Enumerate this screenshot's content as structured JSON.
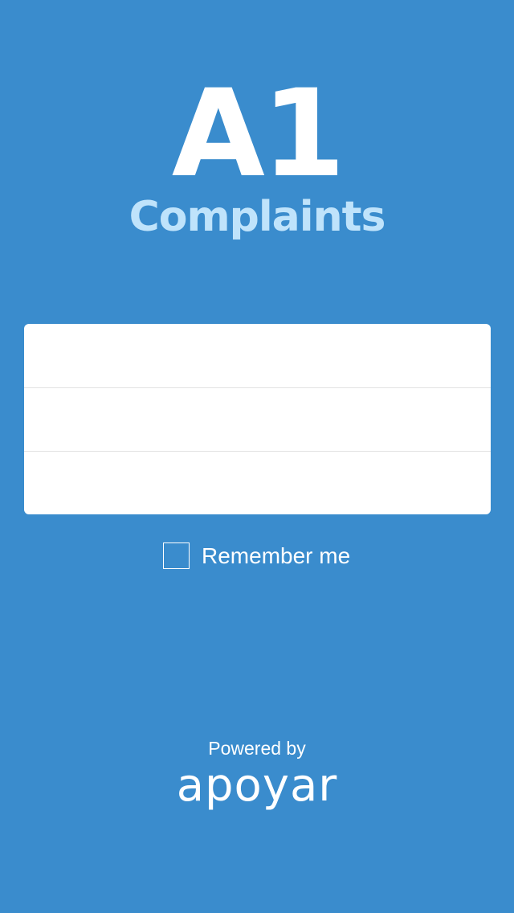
{
  "app": {
    "title": "A1",
    "subtitle": "Complaints"
  },
  "form": {
    "field_1": {
      "value": "",
      "placeholder": ""
    },
    "field_2": {
      "value": "",
      "placeholder": ""
    },
    "field_3": {
      "value": "",
      "placeholder": ""
    }
  },
  "remember": {
    "label": "Remember me",
    "checked": false
  },
  "footer": {
    "powered_by": "Powered by",
    "brand": "apoyar"
  },
  "colors": {
    "background": "#3a8ccd",
    "subtitle": "#bfe3fb",
    "form_background": "#ffffff",
    "text": "#ffffff"
  }
}
